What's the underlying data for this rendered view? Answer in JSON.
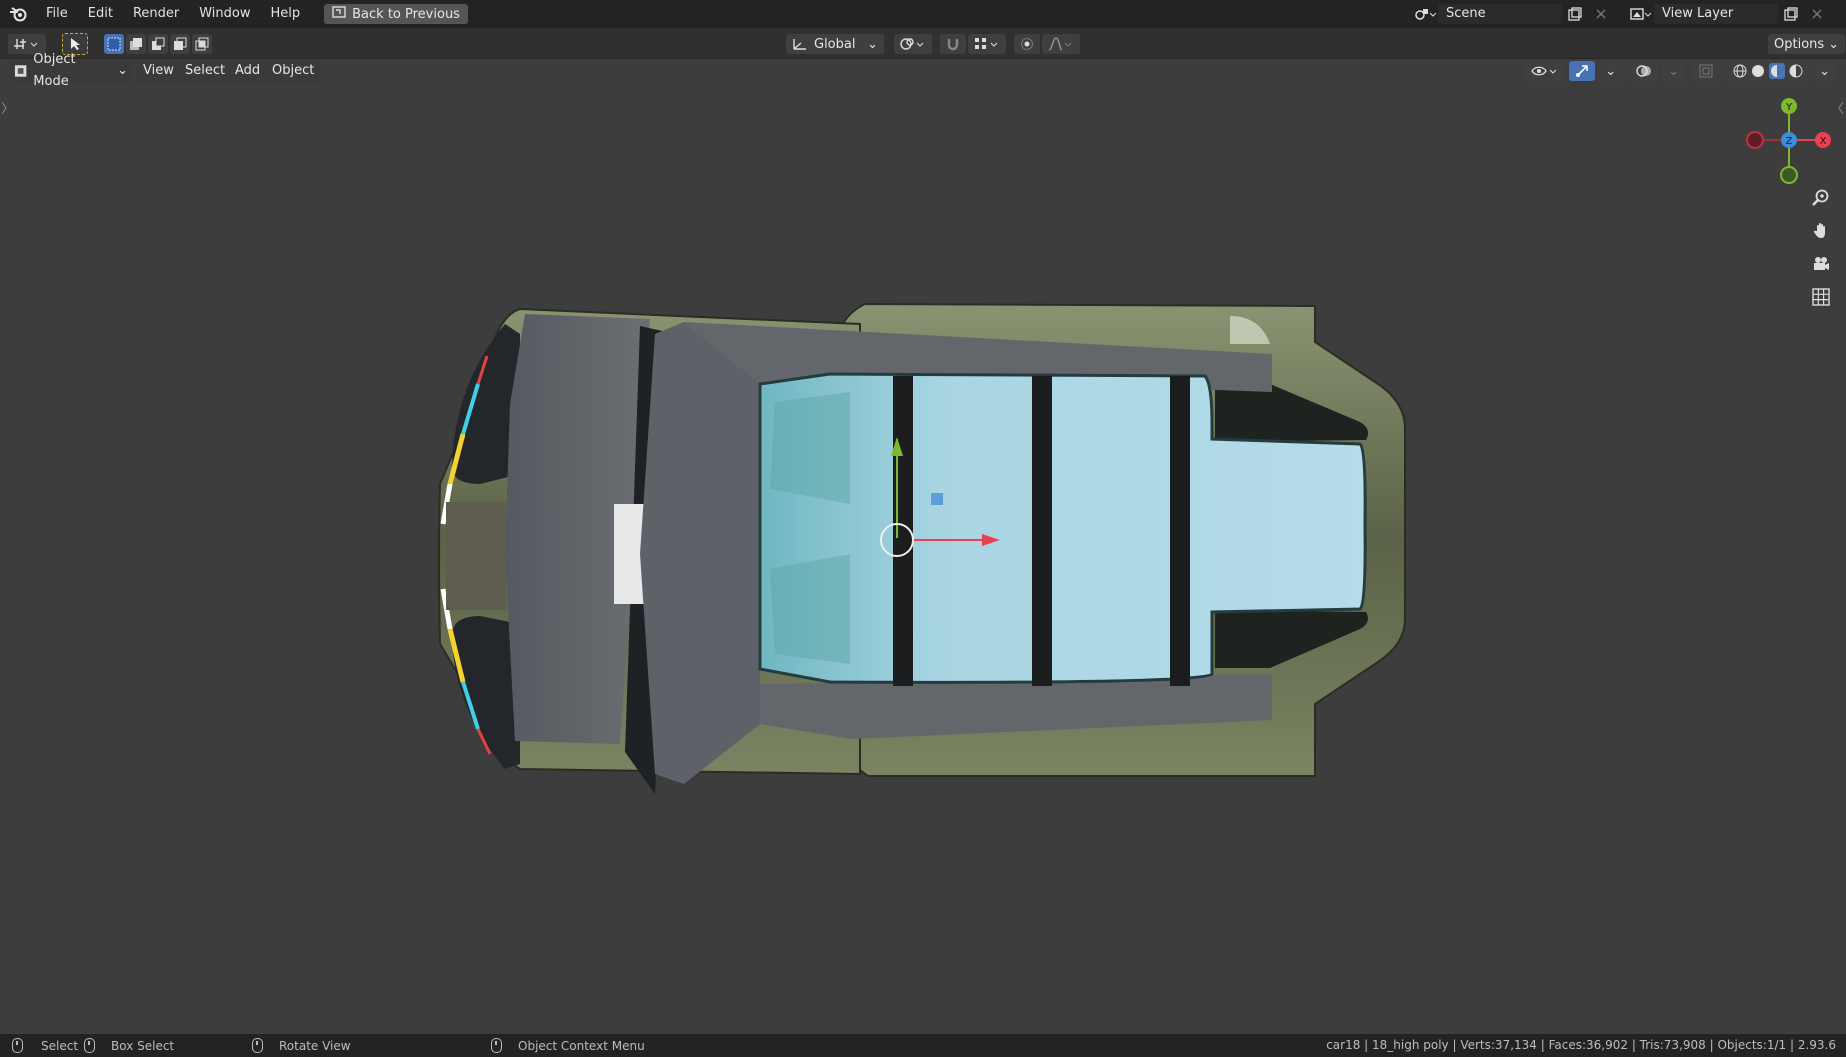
{
  "topbar": {
    "menu": [
      "File",
      "Edit",
      "Render",
      "Window",
      "Help"
    ],
    "back_button": "Back to Previous",
    "scene_label": "Scene",
    "view_layer_label": "View Layer"
  },
  "header": {
    "transform_orientation": "Global",
    "options_label": "Options"
  },
  "viewport_header": {
    "mode": "Object Mode",
    "menus": [
      "View",
      "Select",
      "Add",
      "Object"
    ]
  },
  "gizmo": {
    "y": "Y",
    "z": "Z",
    "x": "X"
  },
  "statusbar": {
    "select": "Select",
    "box_select": "Box Select",
    "rotate_view": "Rotate View",
    "context_menu": "Object Context Menu",
    "stats": "car18 | 18_high poly | Verts:37,134 | Faces:36,902 | Tris:73,908 | Objects:1/1 | 2.93.6"
  },
  "colors": {
    "accent": "#4772b3",
    "axis_x": "#e8414f",
    "axis_y": "#7eb82e",
    "axis_z": "#3b8ed8",
    "glass": "#a7d3df",
    "body": "#6e7558"
  }
}
